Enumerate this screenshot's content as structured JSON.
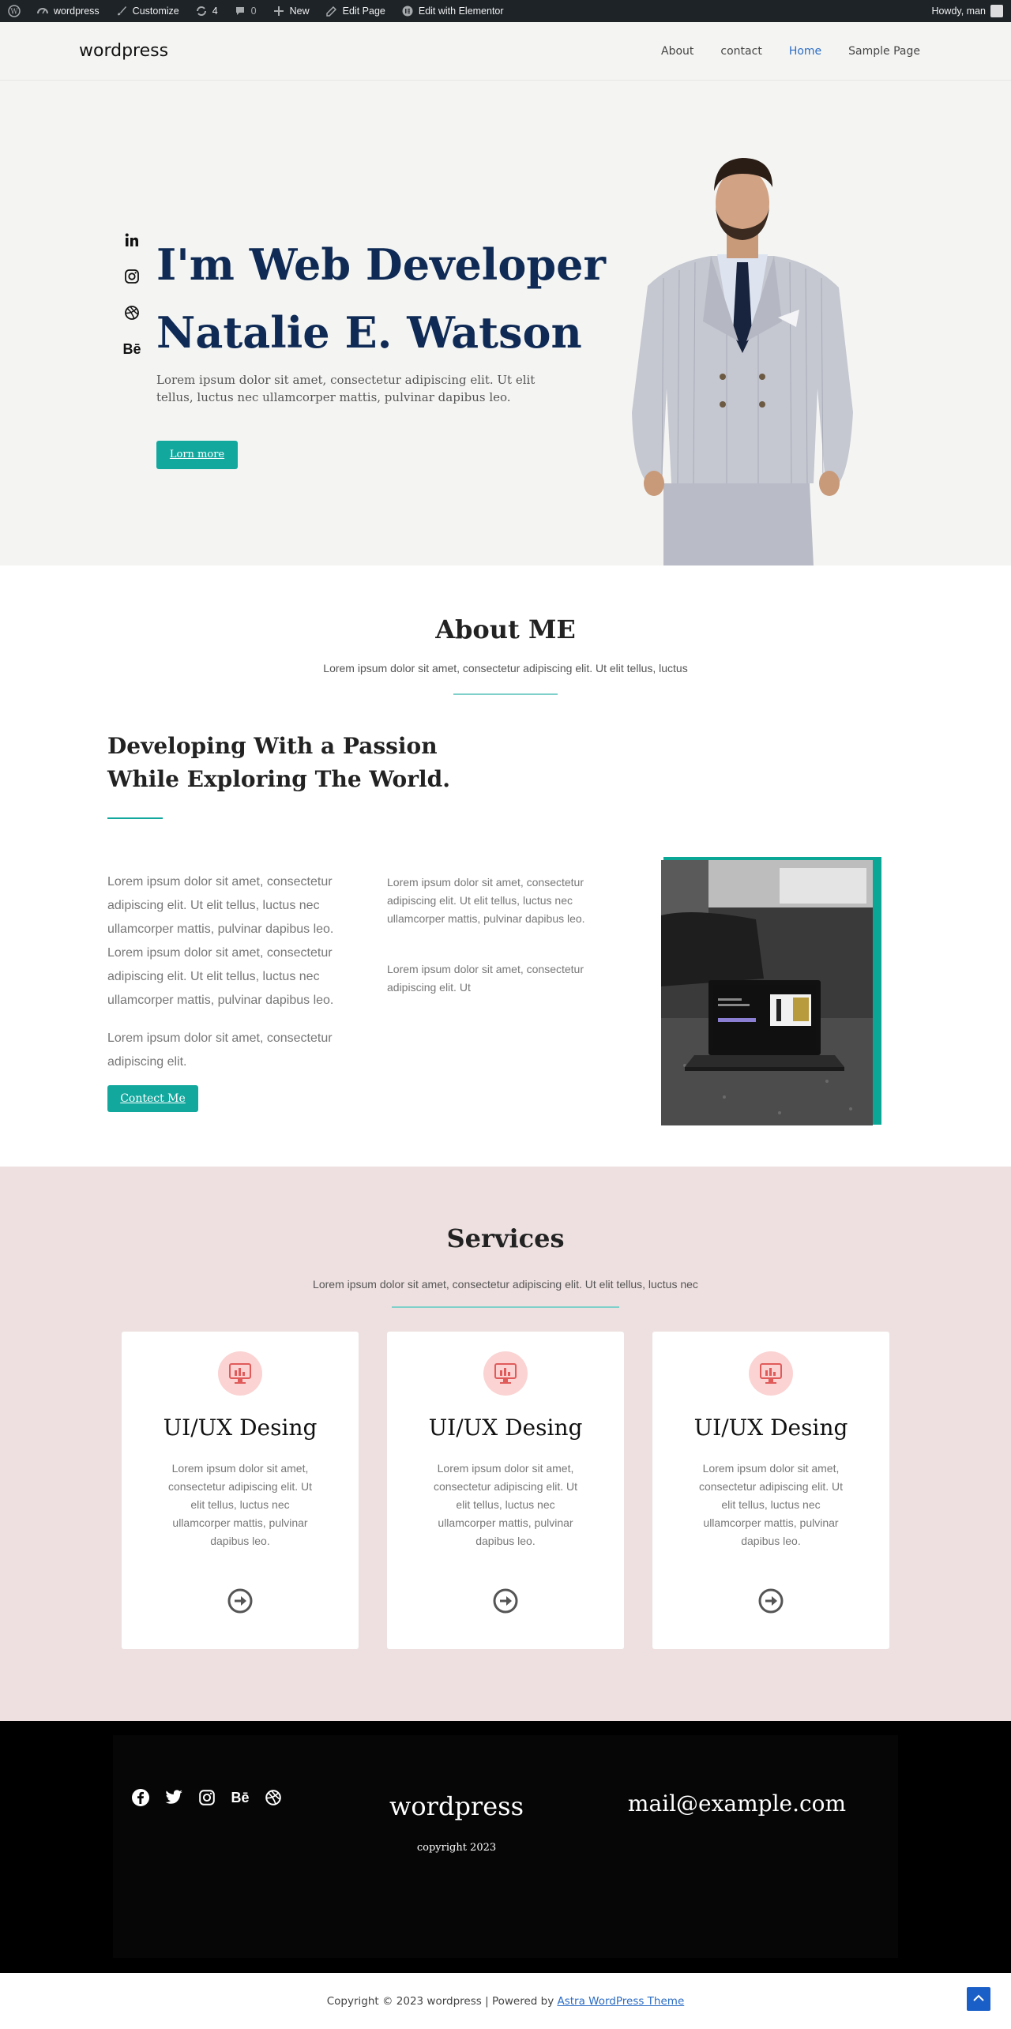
{
  "admin_bar": {
    "site_name": "wordpress",
    "customize": "Customize",
    "updates_count": "4",
    "comments_count": "0",
    "new": "New",
    "edit_page": "Edit Page",
    "edit_elementor": "Edit with Elementor",
    "howdy": "Howdy, man"
  },
  "header": {
    "brand": "wordpress",
    "menu": [
      "About",
      "contact",
      "Home",
      "Sample Page"
    ],
    "active_menu": "Home"
  },
  "hero": {
    "socials": [
      "linkedin-icon",
      "instagram-icon",
      "dribbble-icon",
      "behance-icon"
    ],
    "behance_glyph": "Bē",
    "title_line1": "I'm Web Developer",
    "title_line2": "Natalie E. Watson",
    "description": "Lorem ipsum dolor sit amet, consectetur adipiscing elit. Ut elit tellus, luctus nec ullamcorper mattis, pulvinar dapibus leo.",
    "button": "Lorn more"
  },
  "about": {
    "title": "About ME",
    "subtitle": "Lorem ipsum dolor sit amet, consectetur adipiscing elit. Ut elit tellus, luctus",
    "heading_line1": "Developing With a Passion",
    "heading_line2": "While Exploring The World.",
    "paragraph1": "Lorem ipsum dolor sit amet, consectetur adipiscing elit. Ut elit tellus, luctus nec ullamcorper mattis, pulvinar dapibus leo. Lorem ipsum dolor sit amet, consectetur adipiscing elit. Ut elit tellus, luctus nec ullamcorper mattis, pulvinar dapibus leo.",
    "paragraph2": "Lorem ipsum dolor sit amet, consectetur adipiscing elit.",
    "button": "Contect Me",
    "column_text1": "Lorem ipsum dolor sit amet, consectetur adipiscing elit. Ut elit tellus, luctus nec ullamcorper mattis, pulvinar dapibus leo.",
    "column_text2": "Lorem ipsum dolor sit amet, consectetur adipiscing elit. Ut"
  },
  "services": {
    "title": "Services",
    "subtitle": "Lorem ipsum dolor sit amet, consectetur adipiscing elit. Ut elit tellus, luctus nec",
    "cards": [
      {
        "title": "UI/UX Desing",
        "description": "Lorem ipsum dolor sit amet, consectetur adipiscing elit. Ut elit tellus, luctus nec ullamcorper mattis, pulvinar dapibus leo."
      },
      {
        "title": "UI/UX Desing",
        "description": "Lorem ipsum dolor sit amet, consectetur adipiscing elit. Ut elit tellus, luctus nec ullamcorper mattis, pulvinar dapibus leo."
      },
      {
        "title": "UI/UX Desing",
        "description": "Lorem ipsum dolor sit amet, consectetur adipiscing elit. Ut elit tellus, luctus nec ullamcorper mattis, pulvinar dapibus leo."
      }
    ]
  },
  "footer": {
    "socials": [
      "facebook-icon",
      "twitter-icon",
      "instagram-icon",
      "behance-icon",
      "dribbble-icon"
    ],
    "behance_glyph": "Bē",
    "brand": "wordpress",
    "copyright": "copyright 2023",
    "email": "mail@example.com",
    "bottom_prefix": "Copyright © 2023 wordpress | Powered by ",
    "bottom_link": "Astra WordPress Theme"
  },
  "colors": {
    "accent": "#13a89e",
    "hero_title": "#0f2a55",
    "services_bg": "#eee0e0",
    "link": "#2b6cc4"
  }
}
